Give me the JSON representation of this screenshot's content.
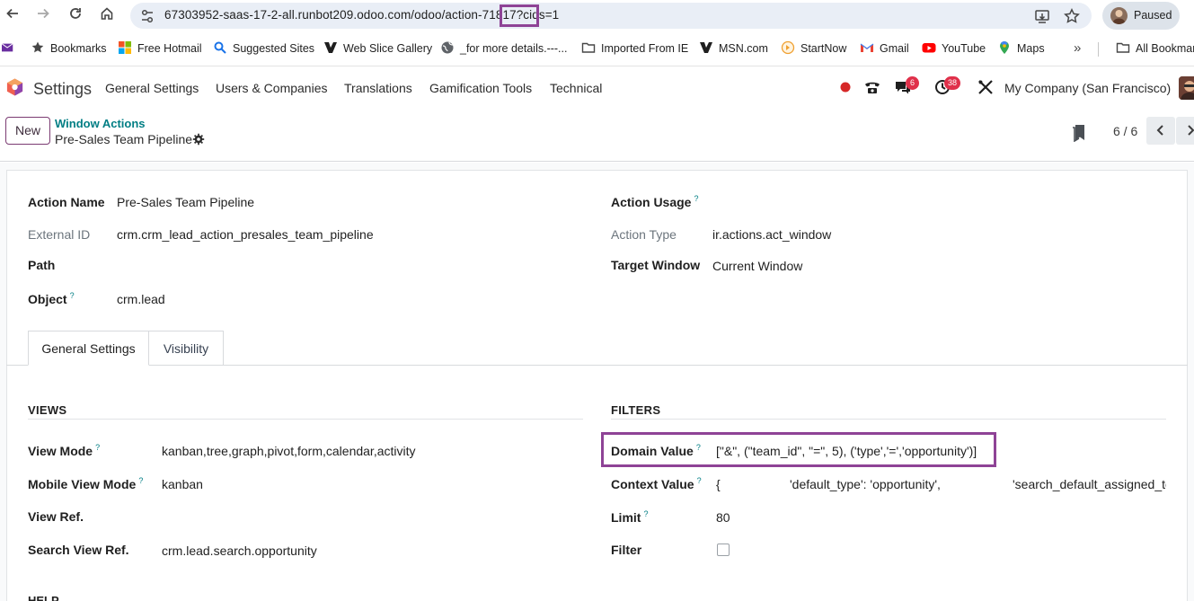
{
  "browser": {
    "url_prefix": "67303952-saas-17-2-all.runbot209.odoo.com/odoo/action-7",
    "url_highlight": "1817",
    "url_suffix": "?cids=1",
    "profile_label": "Paused"
  },
  "bookmarks": [
    {
      "label": "Bookmarks",
      "icon": "star-icon"
    },
    {
      "label": "Free Hotmail",
      "icon": "windows-icon"
    },
    {
      "label": "Suggested Sites",
      "icon": "search-icon"
    },
    {
      "label": "Web Slice Gallery",
      "icon": "slice-icon"
    },
    {
      "label": "_for more details.---...",
      "icon": "globe-icon"
    },
    {
      "label": "Imported From IE",
      "icon": "folder-icon"
    },
    {
      "label": "MSN.com",
      "icon": "msn-icon"
    },
    {
      "label": "StartNow",
      "icon": "startnow-icon"
    },
    {
      "label": "Gmail",
      "icon": "gmail-icon"
    },
    {
      "label": "YouTube",
      "icon": "youtube-icon"
    },
    {
      "label": "Maps",
      "icon": "maps-icon"
    },
    {
      "label": "All Bookmarks",
      "icon": "folder-icon"
    }
  ],
  "navbar": {
    "app_name": "Settings",
    "menu": [
      "General Settings",
      "Users & Companies",
      "Translations",
      "Gamification Tools",
      "Technical"
    ],
    "messages_count": "6",
    "activities_count": "38",
    "company": "My Company (San Francisco)"
  },
  "control_panel": {
    "new_label": "New",
    "breadcrumb_parent": "Window Actions",
    "breadcrumb_current": "Pre-Sales Team Pipeline",
    "pager": "6 / 6"
  },
  "form": {
    "action_name_label": "Action Name",
    "action_name": "Pre-Sales Team Pipeline",
    "external_id_label": "External ID",
    "external_id": "crm.crm_lead_action_presales_team_pipeline",
    "path_label": "Path",
    "object_label": "Object",
    "object": "crm.lead",
    "action_usage_label": "Action Usage",
    "action_type_label": "Action Type",
    "action_type": "ir.actions.act_window",
    "target_window_label": "Target Window",
    "target_window": "Current Window"
  },
  "tabs": [
    "General Settings",
    "Visibility"
  ],
  "views": {
    "title": "VIEWS",
    "view_mode_label": "View Mode",
    "view_mode": "kanban,tree,graph,pivot,form,calendar,activity",
    "mobile_view_mode_label": "Mobile View Mode",
    "mobile_view_mode": "kanban",
    "view_ref_label": "View Ref.",
    "search_view_ref_label": "Search View Ref.",
    "search_view_ref": "crm.lead.search.opportunity"
  },
  "filters": {
    "title": "FILTERS",
    "domain_label": "Domain Value",
    "domain_value": "[\"&\", (\"team_id\", \"=\", 5), ('type','=','opportunity')]",
    "context_label": "Context Value",
    "context_open": "{",
    "context_item1": "'default_type': 'opportunity',",
    "context_item2": "'search_default_assigned_to",
    "limit_label": "Limit",
    "limit": "80",
    "filter_label": "Filter"
  },
  "help": {
    "title": "HELP"
  },
  "colors": {
    "accent_purple": "#8e4396",
    "odoo_teal": "#017e84",
    "badge_red": "#e0304a"
  }
}
